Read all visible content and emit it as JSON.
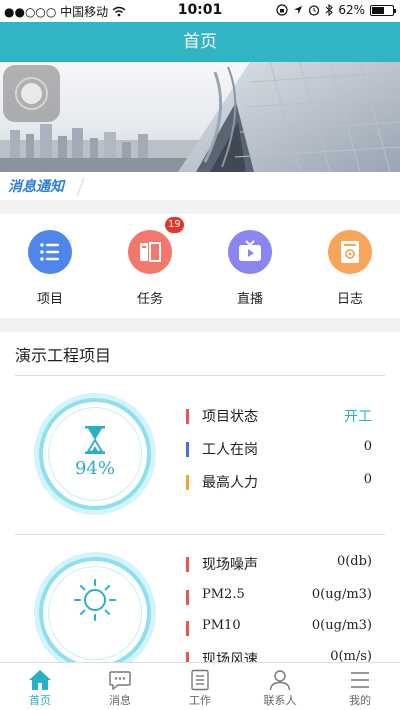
{
  "status_bar": {
    "carrier": "●●○○○ 中国移动",
    "time": "10:01",
    "battery": "62%",
    "battery_level": 0.62
  },
  "header": {
    "title": "首页"
  },
  "notice": {
    "tag": "消息通知"
  },
  "menu": {
    "items": [
      {
        "label": "项目",
        "color": "#4f86ec",
        "icon": "list-icon"
      },
      {
        "label": "任务",
        "color": "#f4776b",
        "icon": "task-icon",
        "badge": "19"
      },
      {
        "label": "直播",
        "color": "#8b85f0",
        "icon": "tv-icon"
      },
      {
        "label": "日志",
        "color": "#f7a55a",
        "icon": "log-icon"
      }
    ]
  },
  "project": {
    "title": "演示工程项目",
    "progress": {
      "percent_label": "94%",
      "value": 0.94,
      "rows": [
        {
          "label": "项目状态",
          "value": "开工",
          "bar_color": "#e8554d"
        },
        {
          "label": "工人在岗",
          "value": "0",
          "bar_color": "#3a78d6"
        },
        {
          "label": "最高人力",
          "value": "0",
          "bar_color": "#f2a23c"
        }
      ]
    },
    "environment": {
      "rows": [
        {
          "label": "现场噪声",
          "value": "0(db)"
        },
        {
          "label": "PM2.5",
          "value": "0(ug/m3)"
        },
        {
          "label": "PM10",
          "value": "0(ug/m3)"
        },
        {
          "label": "现场风速",
          "value": "0(m/s)"
        }
      ],
      "bar_color": "#e8554d"
    }
  },
  "tabbar": {
    "items": [
      {
        "label": "首页",
        "icon": "home-icon"
      },
      {
        "label": "消息",
        "icon": "message-icon"
      },
      {
        "label": "工作",
        "icon": "work-icon"
      },
      {
        "label": "联系人",
        "icon": "contacts-icon"
      },
      {
        "label": "我的",
        "icon": "menu-icon"
      }
    ],
    "active_color": "#2ab0c6"
  },
  "theme": {
    "primary": "#31b4c4",
    "accent": "#2ab0c6"
  }
}
